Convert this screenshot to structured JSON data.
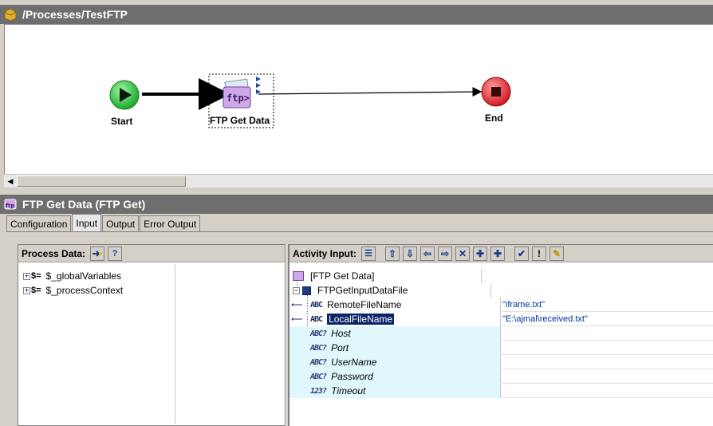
{
  "process": {
    "title": "/Processes/TestFTP",
    "nodes": {
      "start": "Start",
      "ftp_get": "FTP Get Data",
      "end": "End"
    },
    "ftp_badge": "ftp>"
  },
  "activity": {
    "title": "FTP Get Data (FTP Get)",
    "tabs": [
      "Configuration",
      "Input",
      "Output",
      "Error Output"
    ],
    "active_tab": "Input"
  },
  "process_data": {
    "header": "Process Data:",
    "items": [
      "$_globalVariables",
      "$_processContext"
    ]
  },
  "activity_input": {
    "header": "Activity Input:",
    "root": "[FTP Get Data]",
    "group": "FTPGetInputDataFile",
    "fields": [
      {
        "name": "RemoteFileName",
        "value": "\"iframe.txt\"",
        "optional": false,
        "type": "ABC"
      },
      {
        "name": "LocalFileName",
        "value": "\"E:\\ajmal\\received.txt\"",
        "optional": false,
        "type": "ABC"
      },
      {
        "name": "Host",
        "value": "",
        "optional": true,
        "type": "ABC"
      },
      {
        "name": "Port",
        "value": "",
        "optional": true,
        "type": "ABC"
      },
      {
        "name": "UserName",
        "value": "",
        "optional": true,
        "type": "ABC"
      },
      {
        "name": "Password",
        "value": "",
        "optional": true,
        "type": "ABC"
      },
      {
        "name": "Timeout",
        "value": "",
        "optional": true,
        "type": "123"
      }
    ]
  },
  "colors": {
    "title_bar": "#6e6e6e",
    "start_node": "#2ecc40",
    "end_node": "#e8333a",
    "selection": "#0a246a",
    "optional_row": "#e0f8fc"
  }
}
